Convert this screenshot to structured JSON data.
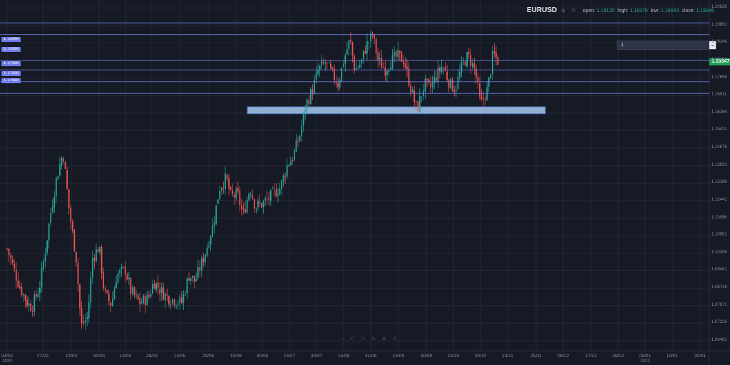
{
  "legend": {
    "symbol": "EURUSD",
    "icons": [
      "eye-icon",
      "gear-icon"
    ],
    "open_label": "open:",
    "open": "1.18125",
    "high_label": "high:",
    "high": "1.18379",
    "low_label": "low:",
    "low": "1.18063",
    "close_label": "close:",
    "close": "1.18346"
  },
  "colors": {
    "background": "#161a25",
    "up": "#26a69a",
    "down": "#ef5350",
    "grid": "#232838",
    "hline": "#6f7de8",
    "zone_fill": "#a9c7f0",
    "zone_border": "#4d83d8",
    "price_tag": "#1f9e57"
  },
  "input_box": {
    "value": "1"
  },
  "price_tag": "1.18347",
  "hline_tags": [
    "1.19999",
    "1.19500",
    "1.17999",
    "1.17500",
    "1.17000"
  ],
  "toolbar_icons": [
    "arrow-left-icon",
    "undo-icon",
    "redo-icon",
    "zoom-out-icon",
    "zoom-in-icon",
    "reset-icon"
  ],
  "chart_data": {
    "type": "candlestick",
    "symbol": "EURUSD",
    "ylim": [
      1.0645,
      1.207
    ],
    "y_ticks": [
      "1.20636",
      "1.19891",
      "1.19146",
      "1.18401",
      "1.17656",
      "1.16911",
      "1.16166",
      "1.15421",
      "1.14676",
      "1.13931",
      "1.13186",
      "1.12441",
      "1.11696",
      "1.10951",
      "1.10206",
      "1.09461",
      "1.08716",
      "1.07971",
      "1.07226",
      "1.06481"
    ],
    "x_ticks": [
      "04/02",
      "27/02",
      "13/03",
      "30/03",
      "14/04",
      "29/04",
      "14/05",
      "29/05",
      "15/06",
      "30/06",
      "15/07",
      "30/07",
      "14/08",
      "31/08",
      "15/09",
      "30/09",
      "15/10",
      "30/10",
      "14/11",
      "25/11",
      "06/12",
      "17/12",
      "28/12",
      "08/01",
      "19/01",
      "30/01"
    ],
    "year_labels": [
      {
        "label": "2020",
        "x_tick": "04/02"
      },
      {
        "label": "2021",
        "x_tick": "08/01"
      }
    ],
    "horizontal_levels": [
      1.19999,
      1.195,
      1.184,
      1.17999,
      1.175,
      1.17
    ],
    "support_zone": {
      "top": 1.1643,
      "bottom": 1.1614,
      "from": "16/06",
      "to": "12/11"
    },
    "close_path": [
      [
        "04/02",
        1.104
      ],
      [
        "07/02",
        1.098
      ],
      [
        "12/02",
        1.088
      ],
      [
        "17/02",
        1.081
      ],
      [
        "20/02",
        1.079
      ],
      [
        "25/02",
        1.088
      ],
      [
        "28/02",
        1.102
      ],
      [
        "03/03",
        1.12
      ],
      [
        "06/03",
        1.135
      ],
      [
        "09/03",
        1.145
      ],
      [
        "12/03",
        1.12
      ],
      [
        "16/03",
        1.1
      ],
      [
        "19/03",
        1.071
      ],
      [
        "23/03",
        1.075
      ],
      [
        "26/03",
        1.1
      ],
      [
        "30/03",
        1.105
      ],
      [
        "02/04",
        1.085
      ],
      [
        "06/04",
        1.08
      ],
      [
        "09/04",
        1.093
      ],
      [
        "14/04",
        1.095
      ],
      [
        "17/04",
        1.086
      ],
      [
        "22/04",
        1.081
      ],
      [
        "27/04",
        1.083
      ],
      [
        "30/04",
        1.09
      ],
      [
        "05/05",
        1.085
      ],
      [
        "08/05",
        1.083
      ],
      [
        "12/05",
        1.082
      ],
      [
        "15/05",
        1.081
      ],
      [
        "19/05",
        1.093
      ],
      [
        "22/05",
        1.09
      ],
      [
        "27/05",
        1.101
      ],
      [
        "01/06",
        1.114
      ],
      [
        "05/06",
        1.13
      ],
      [
        "09/06",
        1.134
      ],
      [
        "12/06",
        1.126
      ],
      [
        "16/06",
        1.127
      ],
      [
        "19/06",
        1.118
      ],
      [
        "23/06",
        1.13
      ],
      [
        "26/06",
        1.122
      ],
      [
        "30/06",
        1.123
      ],
      [
        "03/07",
        1.125
      ],
      [
        "07/07",
        1.128
      ],
      [
        "10/07",
        1.13
      ],
      [
        "14/07",
        1.14
      ],
      [
        "17/07",
        1.143
      ],
      [
        "21/07",
        1.153
      ],
      [
        "24/07",
        1.165
      ],
      [
        "28/07",
        1.172
      ],
      [
        "31/07",
        1.18
      ],
      [
        "04/08",
        1.183
      ],
      [
        "07/08",
        1.179
      ],
      [
        "11/08",
        1.174
      ],
      [
        "14/08",
        1.184
      ],
      [
        "18/08",
        1.193
      ],
      [
        "21/08",
        1.18
      ],
      [
        "25/08",
        1.183
      ],
      [
        "28/08",
        1.19
      ],
      [
        "01/09",
        1.195
      ],
      [
        "04/09",
        1.184
      ],
      [
        "08/09",
        1.18
      ],
      [
        "11/09",
        1.184
      ],
      [
        "15/09",
        1.186
      ],
      [
        "18/09",
        1.184
      ],
      [
        "22/09",
        1.171
      ],
      [
        "25/09",
        1.163
      ],
      [
        "29/09",
        1.174
      ],
      [
        "02/10",
        1.172
      ],
      [
        "06/10",
        1.178
      ],
      [
        "09/10",
        1.182
      ],
      [
        "13/10",
        1.174
      ],
      [
        "16/10",
        1.172
      ],
      [
        "20/10",
        1.182
      ],
      [
        "23/10",
        1.186
      ],
      [
        "27/10",
        1.18
      ],
      [
        "30/10",
        1.165
      ],
      [
        "03/11",
        1.172
      ],
      [
        "06/11",
        1.187
      ],
      [
        "09/11",
        1.1835
      ]
    ]
  }
}
